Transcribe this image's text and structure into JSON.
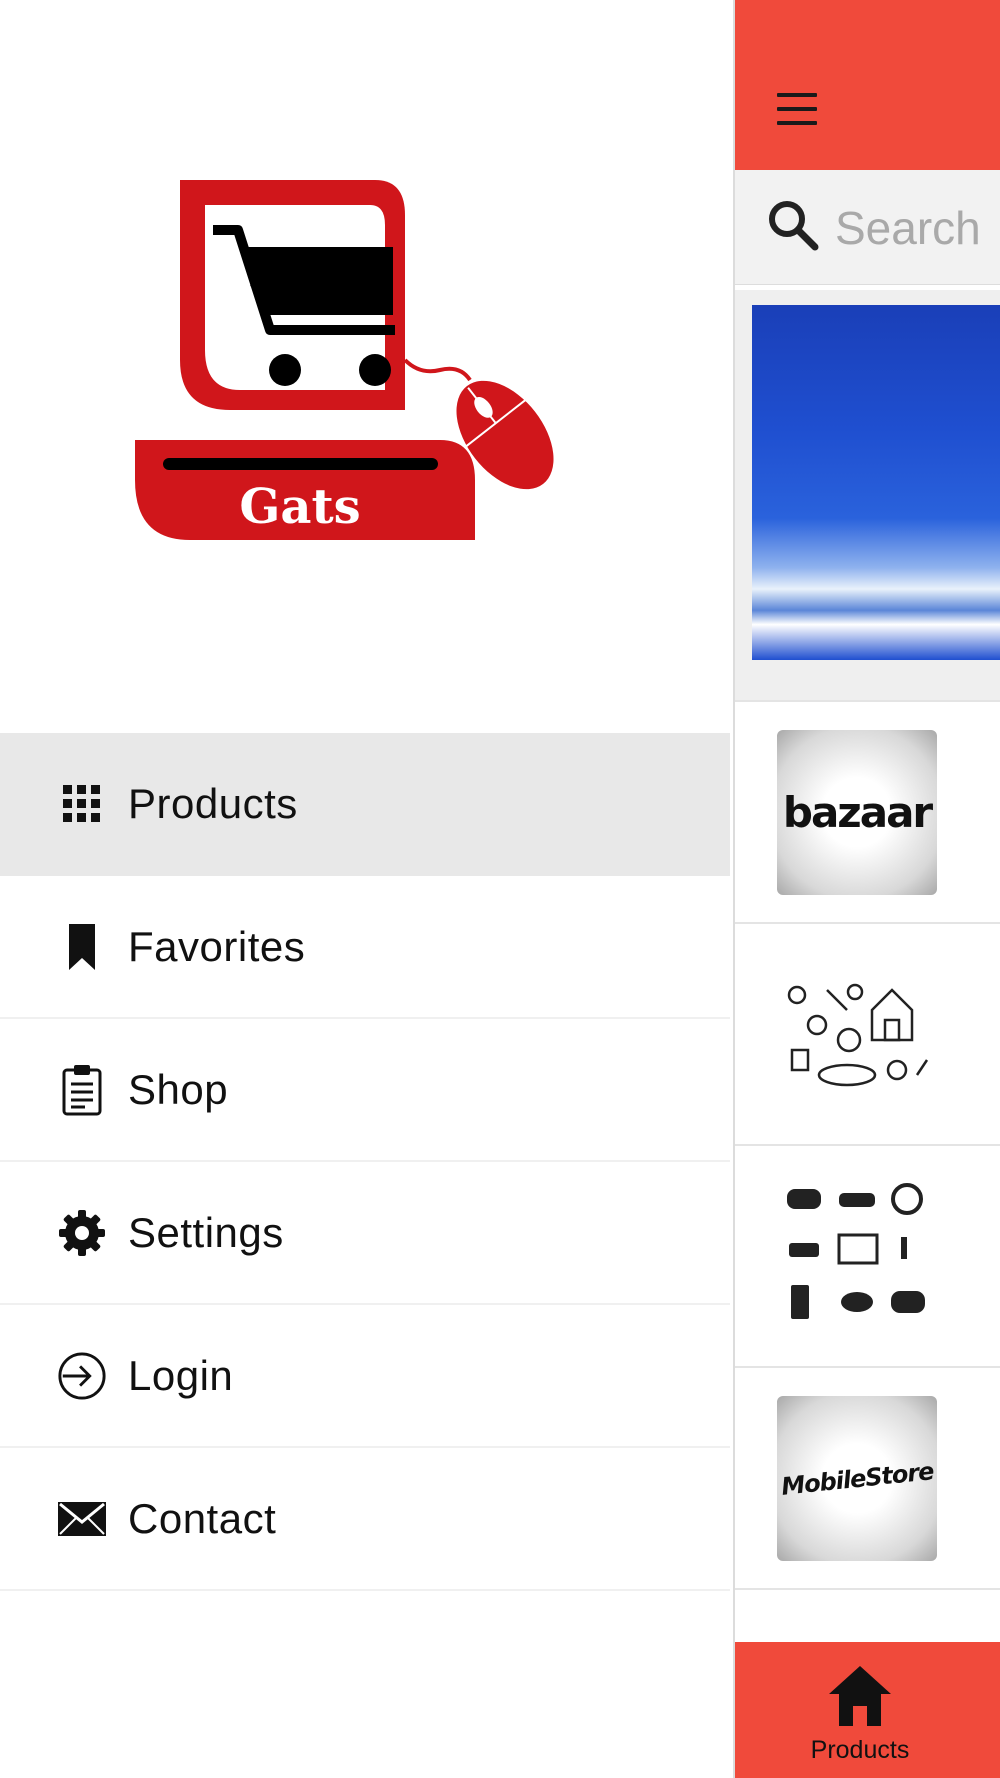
{
  "drawer": {
    "logo": {
      "name": "gats-logo",
      "text": "Gats",
      "color": "#d0161b"
    },
    "items": [
      {
        "label": "Products",
        "icon": "grid-icon",
        "active": true
      },
      {
        "label": "Favorites",
        "icon": "bookmark-icon",
        "active": false
      },
      {
        "label": "Shop",
        "icon": "clipboard-icon",
        "active": false
      },
      {
        "label": "Settings",
        "icon": "gear-icon",
        "active": false
      },
      {
        "label": "Login",
        "icon": "login-icon",
        "active": false
      },
      {
        "label": "Contact",
        "icon": "mail-icon",
        "active": false
      }
    ]
  },
  "app": {
    "header_color": "#f04a3b",
    "search": {
      "placeholder": "Search"
    },
    "list": [
      {
        "thumb_text": "bazaar"
      },
      {
        "thumb_icon": "pet-supplies-icon"
      },
      {
        "thumb_icon": "game-controllers-icon"
      },
      {
        "thumb_text": "MobileStore"
      }
    ],
    "bottom_tab": {
      "label": "Products",
      "icon": "home-icon"
    }
  }
}
